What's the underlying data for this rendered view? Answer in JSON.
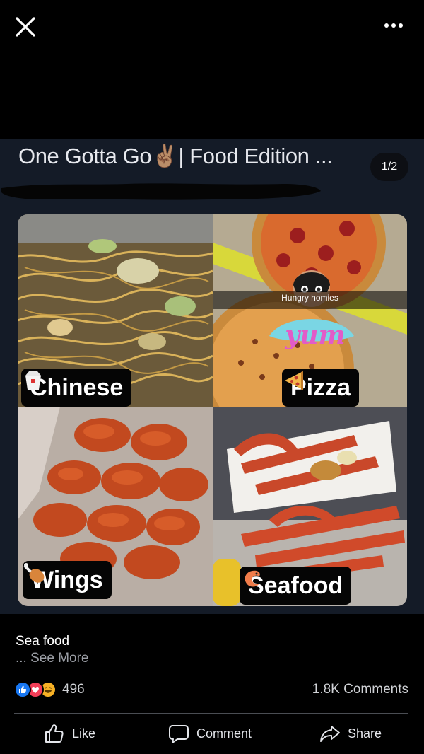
{
  "viewer": {
    "close_icon": "close-icon",
    "more_icon": "more-horizontal-icon",
    "page_counter": "1/2"
  },
  "post_image": {
    "title": "One Gotta Go✌🏽| Food Edition ...",
    "tiles": [
      {
        "label": "Chinese",
        "icon": "takeout-box-icon"
      },
      {
        "label": "Pizza",
        "icon": "pizza-slice-icon"
      },
      {
        "label": "Wings",
        "icon": "chicken-leg-icon"
      },
      {
        "label": "Seafood",
        "icon": "shrimp-icon"
      }
    ],
    "sticker_text": "Hungry homies",
    "sticker_word": "yum"
  },
  "post": {
    "caption": "Sea food",
    "see_more": "... See More",
    "reaction_count": "496",
    "comments_count": "1.8K Comments",
    "reactions": [
      "like-reaction-icon",
      "love-reaction-icon",
      "haha-reaction-icon"
    ]
  },
  "actions": {
    "like": "Like",
    "comment": "Comment",
    "share": "Share"
  },
  "colors": {
    "background": "#000000",
    "image_bg": "#141b27",
    "like_blue": "#1877f2",
    "love_red": "#f33e58",
    "haha_yellow": "#f7b125"
  }
}
